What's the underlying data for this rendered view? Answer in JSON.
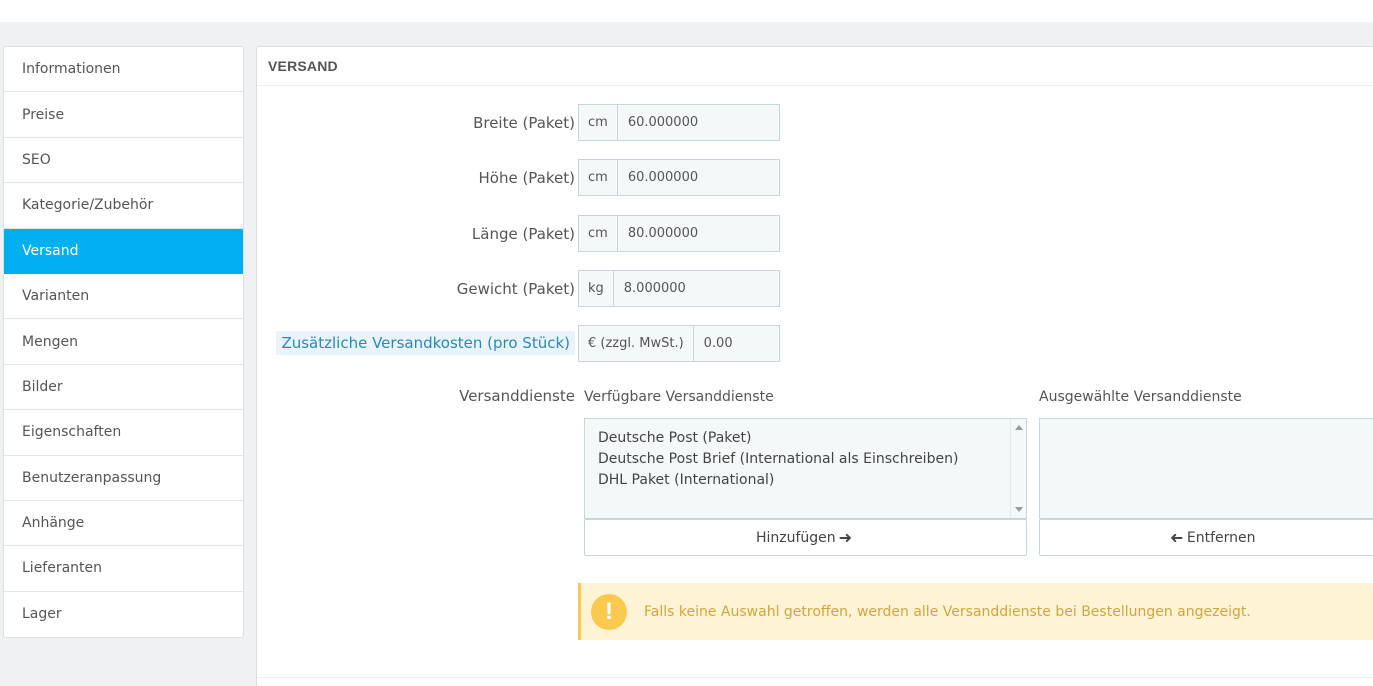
{
  "sidebar": {
    "items": [
      {
        "label": "Informationen"
      },
      {
        "label": "Preise"
      },
      {
        "label": "SEO"
      },
      {
        "label": "Kategorie/Zubehör"
      },
      {
        "label": "Versand",
        "active": true
      },
      {
        "label": "Varianten"
      },
      {
        "label": "Mengen"
      },
      {
        "label": "Bilder"
      },
      {
        "label": "Eigenschaften"
      },
      {
        "label": "Benutzeranpassung"
      },
      {
        "label": "Anhänge"
      },
      {
        "label": "Lieferanten"
      },
      {
        "label": "Lager"
      }
    ]
  },
  "panel": {
    "title": "VERSAND",
    "fields": {
      "width": {
        "label": "Breite (Paket)",
        "unit": "cm",
        "value": "60.000000"
      },
      "height": {
        "label": "Höhe (Paket)",
        "unit": "cm",
        "value": "60.000000"
      },
      "depth": {
        "label": "Länge (Paket)",
        "unit": "cm",
        "value": "80.000000"
      },
      "weight": {
        "label": "Gewicht (Paket)",
        "unit": "kg",
        "value": "8.000000"
      },
      "extra_cost": {
        "label": "Zusätzliche Versandkosten (pro Stück)",
        "unit": "€ (zzgl. MwSt.)",
        "value": "0.00"
      }
    },
    "carriers": {
      "label": "Versanddienste",
      "available_label": "Verfügbare Versanddienste",
      "selected_label": "Ausgewählte Versanddienste",
      "available": [
        "Deutsche Post (Paket)",
        "Deutsche Post Brief (International als Einschreiben)",
        "DHL Paket (International)"
      ],
      "add_button": "Hinzufügen",
      "remove_button": "Entfernen"
    },
    "alert": {
      "icon": "!",
      "text": "Falls keine Auswahl getroffen, werden alle Versanddienste bei Bestellungen angezeigt."
    }
  },
  "colors": {
    "accent": "#00aff0",
    "warning": "#fcc94f",
    "help_text": "#2c89b7"
  }
}
